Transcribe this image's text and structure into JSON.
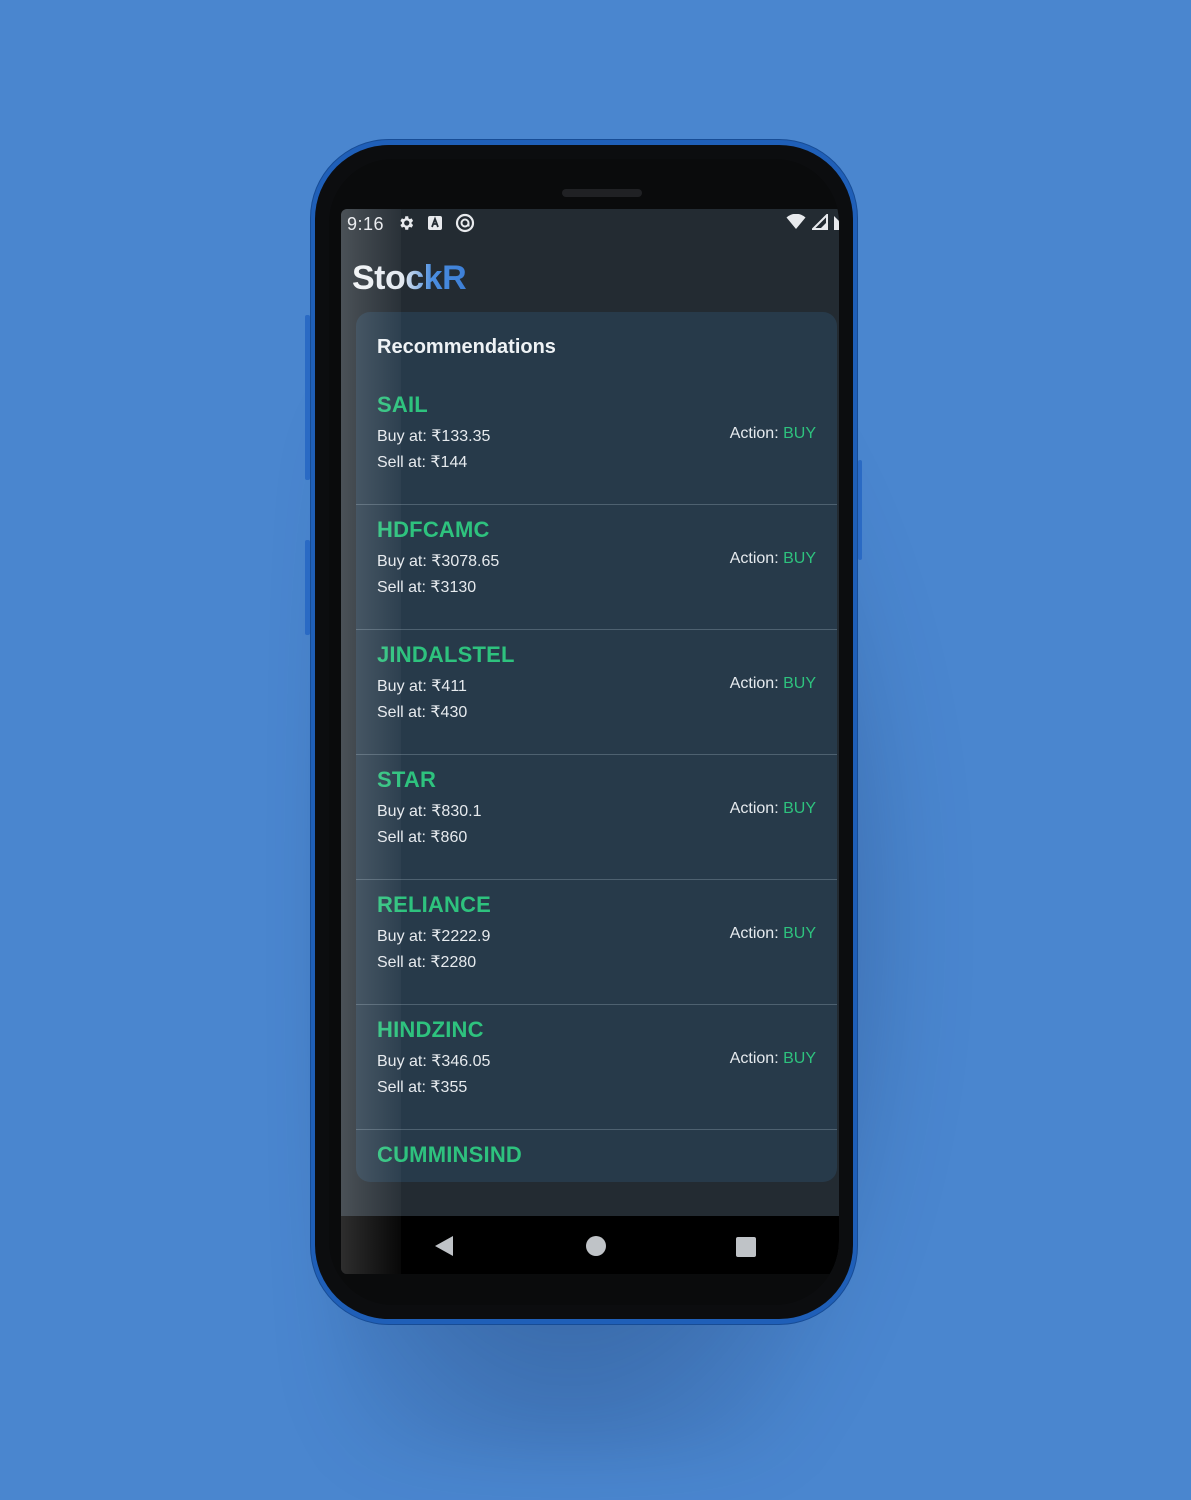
{
  "statusbar": {
    "time": "9:16",
    "left_icons": [
      "gear-icon",
      "a-box-icon",
      "circle-at-icon"
    ],
    "right_icons": [
      "wifi-icon",
      "signal-icon",
      "battery-icon"
    ]
  },
  "app": {
    "title": "StockR"
  },
  "recommendations": {
    "heading": "Recommendations",
    "action_label": "Action:",
    "items": [
      {
        "symbol": "SAIL",
        "buy": "Buy at: ₹133.35",
        "sell": "Sell at: ₹144",
        "action": "BUY"
      },
      {
        "symbol": "HDFCAMC",
        "buy": "Buy at: ₹3078.65",
        "sell": "Sell at: ₹3130",
        "action": "BUY"
      },
      {
        "symbol": "JINDALSTEL",
        "buy": "Buy at: ₹411",
        "sell": "Sell at: ₹430",
        "action": "BUY"
      },
      {
        "symbol": "STAR",
        "buy": "Buy at: ₹830.1",
        "sell": "Sell at: ₹860",
        "action": "BUY"
      },
      {
        "symbol": "RELIANCE",
        "buy": "Buy at: ₹2222.9",
        "sell": "Sell at: ₹2280",
        "action": "BUY"
      },
      {
        "symbol": "HINDZINC",
        "buy": "Buy at: ₹346.05",
        "sell": "Sell at: ₹355",
        "action": "BUY"
      },
      {
        "symbol": "CUMMINSIND",
        "buy": "",
        "sell": "",
        "action": ""
      }
    ]
  },
  "colors": {
    "background": "#4a86cf",
    "phone_frame": "#1f5fb8",
    "screen_bg": "#232b32",
    "card_bg": "#273a4a",
    "accent_green": "#2ec27e",
    "title_blue": "#3d7fd6"
  },
  "navbar": {
    "buttons": [
      "back-icon",
      "home-icon",
      "recents-icon"
    ]
  }
}
